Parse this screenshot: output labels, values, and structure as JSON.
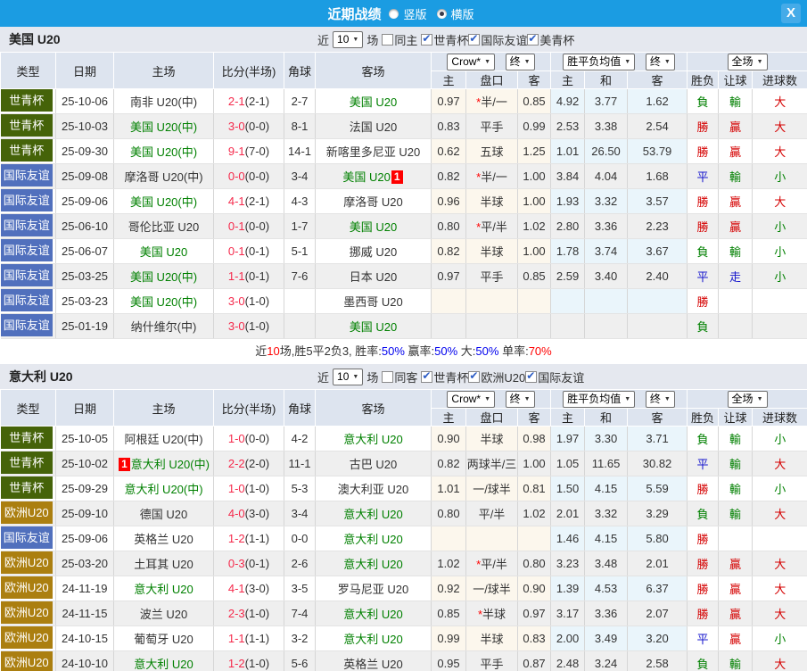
{
  "titlebar": {
    "title": "近期战绩",
    "radios": [
      {
        "label": "竖版",
        "selected": false
      },
      {
        "label": "横版",
        "selected": true
      }
    ],
    "close_label": "X"
  },
  "hdr": {
    "type": "类型",
    "date": "日期",
    "home": "主场",
    "score": "比分(半场)",
    "corner": "角球",
    "away": "客场",
    "crow_dd": "Crow*",
    "final_dd": "终",
    "avg_dd": "胜平负均值",
    "full_dd": "全场",
    "sub": [
      "主",
      "盘口",
      "客",
      "主",
      "和",
      "客",
      "胜负",
      "让球",
      "进球数"
    ]
  },
  "type_styles": {
    "wc": {
      "label": "世青杯",
      "color": "#456309"
    },
    "fr": {
      "label": "国际友谊",
      "color": "#5170bd"
    },
    "eu": {
      "label": "欧洲U20",
      "color": "#ab7f10"
    }
  },
  "sections": [
    {
      "team": "美国 U20",
      "filter": {
        "near": "近",
        "rounds": "10",
        "unit": "场",
        "same": {
          "label": "同主",
          "checked": false
        },
        "comps": [
          {
            "label": "世青杯",
            "checked": true
          },
          {
            "label": "国际友谊",
            "checked": true
          },
          {
            "label": "美青杯",
            "checked": true
          }
        ]
      },
      "rows": [
        {
          "type": "wc",
          "date": "25-10-06",
          "home": {
            "t": "南非 U20(中)",
            "g": false
          },
          "ft": "2-1",
          "ht": "(2-1)",
          "cor": "2-7",
          "away": {
            "t": "美国 U20",
            "g": true
          },
          "crow": [
            "0.97",
            "半/一",
            "0.85"
          ],
          "star": true,
          "avg": [
            "4.92",
            "3.77",
            "1.62"
          ],
          "res": [
            "負",
            "g"
          ],
          "han": [
            "輸",
            "g"
          ],
          "goal": [
            "大",
            "r"
          ]
        },
        {
          "type": "wc",
          "date": "25-10-03",
          "home": {
            "t": "美国 U20(中)",
            "g": true
          },
          "ft": "3-0",
          "ht": "(0-0)",
          "cor": "8-1",
          "away": {
            "t": "法国 U20",
            "g": false
          },
          "crow": [
            "0.83",
            "平手",
            "0.99"
          ],
          "star": false,
          "avg": [
            "2.53",
            "3.38",
            "2.54"
          ],
          "res": [
            "勝",
            "r"
          ],
          "han": [
            "贏",
            "r"
          ],
          "goal": [
            "大",
            "r"
          ]
        },
        {
          "type": "wc",
          "date": "25-09-30",
          "home": {
            "t": "美国 U20(中)",
            "g": true
          },
          "ft": "9-1",
          "ht": "(7-0)",
          "cor": "14-1",
          "away": {
            "t": "新喀里多尼亚 U20",
            "g": false
          },
          "crow": [
            "0.62",
            "五球",
            "1.25"
          ],
          "star": false,
          "avg": [
            "1.01",
            "26.50",
            "53.79"
          ],
          "res": [
            "勝",
            "r"
          ],
          "han": [
            "贏",
            "r"
          ],
          "goal": [
            "大",
            "r"
          ]
        },
        {
          "type": "fr",
          "date": "25-09-08",
          "home": {
            "t": "摩洛哥 U20(中)",
            "g": false
          },
          "ft": "0-0",
          "ht": "(0-0)",
          "cor": "3-4",
          "away": {
            "t": "美国 U20",
            "g": true,
            "b": "post",
            "bt": "1"
          },
          "crow": [
            "0.82",
            "半/一",
            "1.00"
          ],
          "star": true,
          "avg": [
            "3.84",
            "4.04",
            "1.68"
          ],
          "res": [
            "平",
            "b"
          ],
          "han": [
            "輸",
            "g"
          ],
          "goal": [
            "小",
            "g"
          ]
        },
        {
          "type": "fr",
          "date": "25-09-06",
          "home": {
            "t": "美国 U20(中)",
            "g": true
          },
          "ft": "4-1",
          "ht": "(2-1)",
          "cor": "4-3",
          "away": {
            "t": "摩洛哥 U20",
            "g": false
          },
          "crow": [
            "0.96",
            "半球",
            "1.00"
          ],
          "star": false,
          "avg": [
            "1.93",
            "3.32",
            "3.57"
          ],
          "res": [
            "勝",
            "r"
          ],
          "han": [
            "贏",
            "r"
          ],
          "goal": [
            "大",
            "r"
          ]
        },
        {
          "type": "fr",
          "date": "25-06-10",
          "home": {
            "t": "哥伦比亚 U20",
            "g": false
          },
          "ft": "0-1",
          "ht": "(0-0)",
          "cor": "1-7",
          "away": {
            "t": "美国 U20",
            "g": true
          },
          "crow": [
            "0.80",
            "平/半",
            "1.02"
          ],
          "star": true,
          "avg": [
            "2.80",
            "3.36",
            "2.23"
          ],
          "res": [
            "勝",
            "r"
          ],
          "han": [
            "贏",
            "r"
          ],
          "goal": [
            "小",
            "g"
          ]
        },
        {
          "type": "fr",
          "date": "25-06-07",
          "home": {
            "t": "美国 U20",
            "g": true
          },
          "ft": "0-1",
          "ht": "(0-1)",
          "cor": "5-1",
          "away": {
            "t": "挪威 U20",
            "g": false
          },
          "crow": [
            "0.82",
            "半球",
            "1.00"
          ],
          "star": false,
          "avg": [
            "1.78",
            "3.74",
            "3.67"
          ],
          "res": [
            "負",
            "g"
          ],
          "han": [
            "輸",
            "g"
          ],
          "goal": [
            "小",
            "g"
          ]
        },
        {
          "type": "fr",
          "date": "25-03-25",
          "home": {
            "t": "美国 U20(中)",
            "g": true
          },
          "ft": "1-1",
          "ht": "(0-1)",
          "cor": "7-6",
          "away": {
            "t": "日本 U20",
            "g": false
          },
          "crow": [
            "0.97",
            "平手",
            "0.85"
          ],
          "star": false,
          "avg": [
            "2.59",
            "3.40",
            "2.40"
          ],
          "res": [
            "平",
            "b"
          ],
          "han": [
            "走",
            "b"
          ],
          "goal": [
            "小",
            "g"
          ]
        },
        {
          "type": "fr",
          "date": "25-03-23",
          "home": {
            "t": "美国 U20(中)",
            "g": true
          },
          "ft": "3-0",
          "ht": "(1-0)",
          "cor": "",
          "away": {
            "t": "墨西哥 U20",
            "g": false
          },
          "crow": [
            "",
            "",
            ""
          ],
          "star": false,
          "avg": [
            "",
            "",
            ""
          ],
          "res": [
            "勝",
            "r"
          ],
          "han": [
            "",
            ""
          ],
          "goal": [
            "",
            ""
          ]
        },
        {
          "type": "fr",
          "date": "25-01-19",
          "home": {
            "t": "纳什维尔(中)",
            "g": false
          },
          "ft": "3-0",
          "ht": "(1-0)",
          "cor": "",
          "away": {
            "t": "美国 U20",
            "g": true
          },
          "crow": [
            "",
            "",
            ""
          ],
          "star": false,
          "avg": [
            "",
            "",
            ""
          ],
          "res": [
            "負",
            "g"
          ],
          "han": [
            "",
            ""
          ],
          "goal": [
            "",
            ""
          ]
        }
      ],
      "summary": [
        {
          "t": "近",
          "c": "k"
        },
        {
          "t": "10",
          "c": "r"
        },
        {
          "t": "场,胜5平2负3, 胜率:",
          "c": "k"
        },
        {
          "t": "50%",
          "c": "b"
        },
        {
          "t": " 赢率:",
          "c": "k"
        },
        {
          "t": "50%",
          "c": "b"
        },
        {
          "t": " 大:",
          "c": "k"
        },
        {
          "t": "50%",
          "c": "b"
        },
        {
          "t": " 单率:",
          "c": "k"
        },
        {
          "t": "70%",
          "c": "r"
        }
      ]
    },
    {
      "team": "意大利 U20",
      "filter": {
        "near": "近",
        "rounds": "10",
        "unit": "场",
        "same": {
          "label": "同客",
          "checked": false
        },
        "comps": [
          {
            "label": "世青杯",
            "checked": true
          },
          {
            "label": "欧洲U20",
            "checked": true
          },
          {
            "label": "国际友谊",
            "checked": true
          }
        ]
      },
      "rows": [
        {
          "type": "wc",
          "date": "25-10-05",
          "home": {
            "t": "阿根廷 U20(中)",
            "g": false
          },
          "ft": "1-0",
          "ht": "(0-0)",
          "cor": "4-2",
          "away": {
            "t": "意大利 U20",
            "g": true
          },
          "crow": [
            "0.90",
            "半球",
            "0.98"
          ],
          "star": false,
          "avg": [
            "1.97",
            "3.30",
            "3.71"
          ],
          "res": [
            "負",
            "g"
          ],
          "han": [
            "輸",
            "g"
          ],
          "goal": [
            "小",
            "g"
          ]
        },
        {
          "type": "wc",
          "date": "25-10-02",
          "home": {
            "t": "意大利 U20(中)",
            "g": true,
            "b": "pre",
            "bt": "1"
          },
          "ft": "2-2",
          "ht": "(2-0)",
          "cor": "11-1",
          "away": {
            "t": "古巴 U20",
            "g": false
          },
          "crow": [
            "0.82",
            "两球半/三",
            "1.00"
          ],
          "star": false,
          "avg": [
            "1.05",
            "11.65",
            "30.82"
          ],
          "res": [
            "平",
            "b"
          ],
          "han": [
            "輸",
            "g"
          ],
          "goal": [
            "大",
            "r"
          ]
        },
        {
          "type": "wc",
          "date": "25-09-29",
          "home": {
            "t": "意大利 U20(中)",
            "g": true
          },
          "ft": "1-0",
          "ht": "(1-0)",
          "cor": "5-3",
          "away": {
            "t": "澳大利亚 U20",
            "g": false
          },
          "crow": [
            "1.01",
            "一/球半",
            "0.81"
          ],
          "star": false,
          "avg": [
            "1.50",
            "4.15",
            "5.59"
          ],
          "res": [
            "勝",
            "r"
          ],
          "han": [
            "輸",
            "g"
          ],
          "goal": [
            "小",
            "g"
          ]
        },
        {
          "type": "eu",
          "date": "25-09-10",
          "home": {
            "t": "德国 U20",
            "g": false
          },
          "ft": "4-0",
          "ht": "(3-0)",
          "cor": "3-4",
          "away": {
            "t": "意大利 U20",
            "g": true
          },
          "crow": [
            "0.80",
            "平/半",
            "1.02"
          ],
          "star": false,
          "avg": [
            "2.01",
            "3.32",
            "3.29"
          ],
          "res": [
            "負",
            "g"
          ],
          "han": [
            "輸",
            "g"
          ],
          "goal": [
            "大",
            "r"
          ]
        },
        {
          "type": "fr",
          "date": "25-09-06",
          "home": {
            "t": "英格兰 U20",
            "g": false
          },
          "ft": "1-2",
          "ht": "(1-1)",
          "cor": "0-0",
          "away": {
            "t": "意大利 U20",
            "g": true
          },
          "crow": [
            "",
            "",
            ""
          ],
          "star": false,
          "avg": [
            "1.46",
            "4.15",
            "5.80"
          ],
          "res": [
            "勝",
            "r"
          ],
          "han": [
            "",
            ""
          ],
          "goal": [
            "",
            ""
          ]
        },
        {
          "type": "eu",
          "date": "25-03-20",
          "home": {
            "t": "土耳其 U20",
            "g": false
          },
          "ft": "0-3",
          "ht": "(0-1)",
          "cor": "2-6",
          "away": {
            "t": "意大利 U20",
            "g": true
          },
          "crow": [
            "1.02",
            "平/半",
            "0.80"
          ],
          "star": true,
          "avg": [
            "3.23",
            "3.48",
            "2.01"
          ],
          "res": [
            "勝",
            "r"
          ],
          "han": [
            "贏",
            "r"
          ],
          "goal": [
            "大",
            "r"
          ]
        },
        {
          "type": "eu",
          "date": "24-11-19",
          "home": {
            "t": "意大利 U20",
            "g": true
          },
          "ft": "4-1",
          "ht": "(3-0)",
          "cor": "3-5",
          "away": {
            "t": "罗马尼亚 U20",
            "g": false
          },
          "crow": [
            "0.92",
            "一/球半",
            "0.90"
          ],
          "star": false,
          "avg": [
            "1.39",
            "4.53",
            "6.37"
          ],
          "res": [
            "勝",
            "r"
          ],
          "han": [
            "贏",
            "r"
          ],
          "goal": [
            "大",
            "r"
          ]
        },
        {
          "type": "eu",
          "date": "24-11-15",
          "home": {
            "t": "波兰 U20",
            "g": false
          },
          "ft": "2-3",
          "ht": "(1-0)",
          "cor": "7-4",
          "away": {
            "t": "意大利 U20",
            "g": true
          },
          "crow": [
            "0.85",
            "半球",
            "0.97"
          ],
          "star": true,
          "avg": [
            "3.17",
            "3.36",
            "2.07"
          ],
          "res": [
            "勝",
            "r"
          ],
          "han": [
            "贏",
            "r"
          ],
          "goal": [
            "大",
            "r"
          ]
        },
        {
          "type": "eu",
          "date": "24-10-15",
          "home": {
            "t": "葡萄牙 U20",
            "g": false
          },
          "ft": "1-1",
          "ht": "(1-1)",
          "cor": "3-2",
          "away": {
            "t": "意大利 U20",
            "g": true
          },
          "crow": [
            "0.99",
            "半球",
            "0.83"
          ],
          "star": false,
          "avg": [
            "2.00",
            "3.49",
            "3.20"
          ],
          "res": [
            "平",
            "b"
          ],
          "han": [
            "贏",
            "r"
          ],
          "goal": [
            "小",
            "g"
          ]
        },
        {
          "type": "eu",
          "date": "24-10-10",
          "home": {
            "t": "意大利 U20",
            "g": true
          },
          "ft": "1-2",
          "ht": "(1-0)",
          "cor": "5-6",
          "away": {
            "t": "英格兰 U20",
            "g": false
          },
          "crow": [
            "0.95",
            "平手",
            "0.87"
          ],
          "star": false,
          "avg": [
            "2.48",
            "3.24",
            "2.58"
          ],
          "res": [
            "負",
            "g"
          ],
          "han": [
            "輸",
            "g"
          ],
          "goal": [
            "大",
            "r"
          ]
        }
      ]
    }
  ]
}
